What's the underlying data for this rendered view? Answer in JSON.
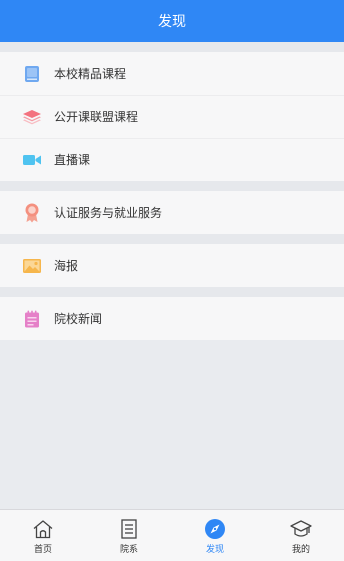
{
  "header": {
    "title": "发现"
  },
  "groups": [
    {
      "items": [
        {
          "label": "本校精品课程",
          "icon": "book-icon"
        },
        {
          "label": "公开课联盟课程",
          "icon": "layers-icon"
        },
        {
          "label": "直播课",
          "icon": "video-camera-icon"
        }
      ]
    },
    {
      "items": [
        {
          "label": "认证服务与就业服务",
          "icon": "award-ribbon-icon"
        }
      ]
    },
    {
      "items": [
        {
          "label": "海报",
          "icon": "image-icon"
        }
      ]
    },
    {
      "items": [
        {
          "label": "院校新闻",
          "icon": "notepad-icon"
        }
      ]
    }
  ],
  "tabbar": {
    "tabs": [
      {
        "label": "首页",
        "icon": "home-icon",
        "active": false
      },
      {
        "label": "院系",
        "icon": "document-list-icon",
        "active": false
      },
      {
        "label": "发现",
        "icon": "compass-icon",
        "active": true
      },
      {
        "label": "我的",
        "icon": "graduation-cap-icon",
        "active": false
      }
    ]
  },
  "colors": {
    "primary": "#2f87f5",
    "book": "#6fa8f0",
    "layers": "#f3727f",
    "video": "#4fc3f0",
    "award": "#f4907f",
    "image": "#f6b64c",
    "notepad": "#e580c8"
  }
}
